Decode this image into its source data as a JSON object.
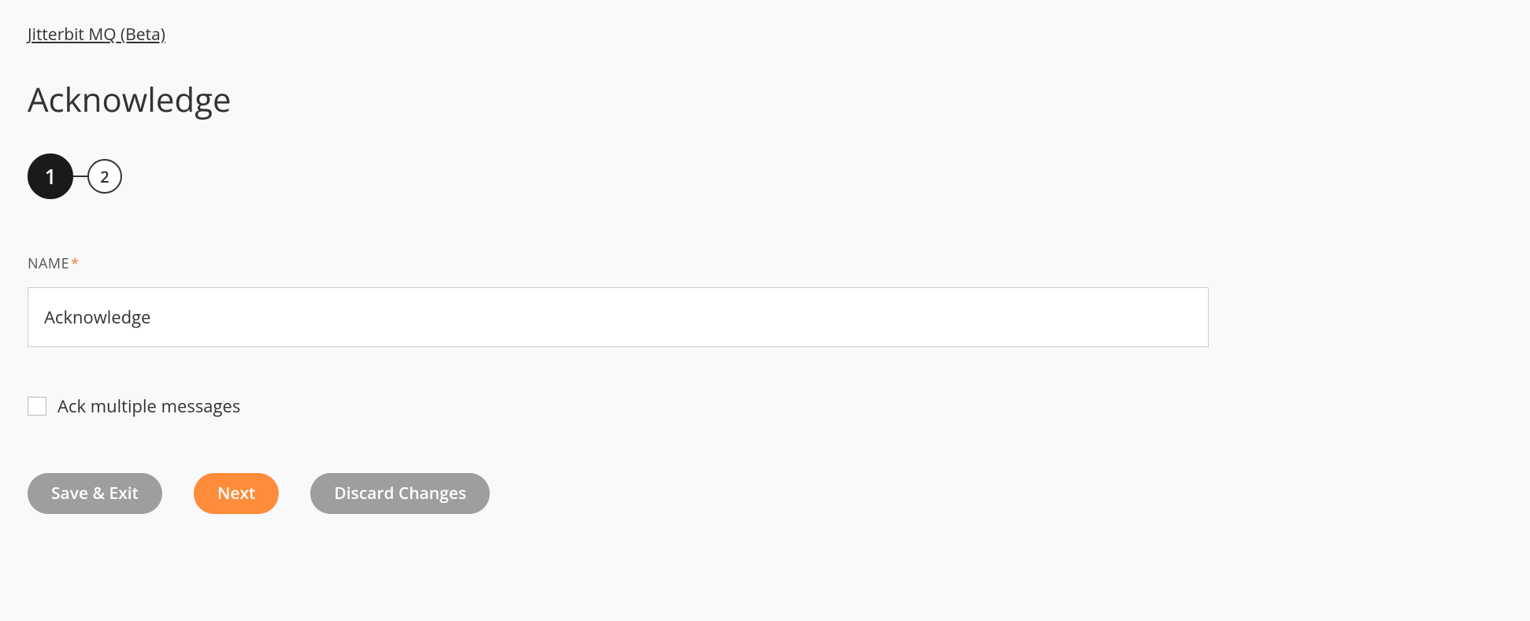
{
  "breadcrumb": {
    "label": "Jitterbit MQ (Beta)"
  },
  "page": {
    "title": "Acknowledge"
  },
  "stepper": {
    "steps": [
      "1",
      "2"
    ],
    "active_index": 0
  },
  "form": {
    "name_label": "NAME",
    "required_mark": "*",
    "name_value": "Acknowledge",
    "ack_multiple_label": "Ack multiple messages",
    "ack_multiple_checked": false
  },
  "buttons": {
    "save_exit": "Save & Exit",
    "next": "Next",
    "discard": "Discard Changes"
  }
}
